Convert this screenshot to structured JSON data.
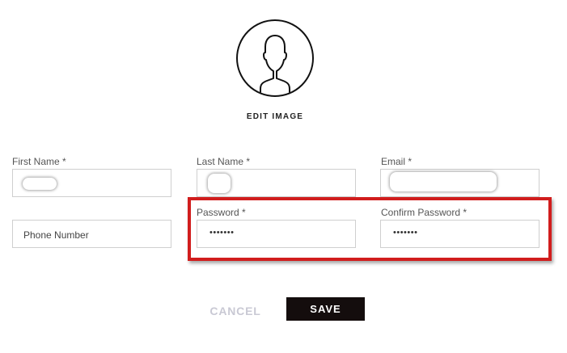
{
  "profile": {
    "edit_image_label": "EDIT IMAGE",
    "avatar_icon": "user-silhouette-icon"
  },
  "form": {
    "first_name": {
      "label": "First Name *",
      "value": ""
    },
    "last_name": {
      "label": "Last Name *",
      "value": ""
    },
    "email": {
      "label": "Email *",
      "value": ""
    },
    "phone": {
      "placeholder": "Phone Number"
    },
    "password": {
      "label": "Password *",
      "value": "•••••••"
    },
    "confirm_password": {
      "label": "Confirm Password *",
      "value": "•••••••"
    }
  },
  "actions": {
    "cancel_label": "CANCEL",
    "save_label": "SAVE"
  },
  "colors": {
    "highlight_border": "#d11d1d",
    "save_bg": "#140d0d",
    "cancel_text": "#c9c9d4"
  }
}
